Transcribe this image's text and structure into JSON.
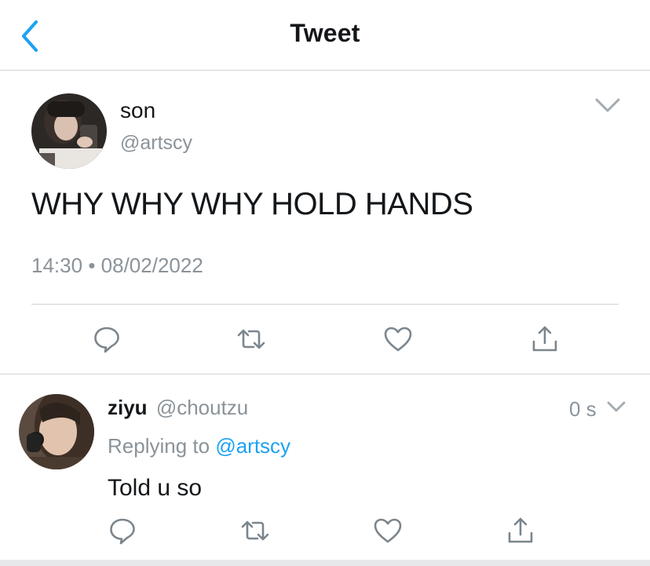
{
  "header": {
    "title": "Tweet",
    "back_icon": "chevron-left-icon",
    "accent": "#1da1f2"
  },
  "tweet": {
    "author_name": "son",
    "author_handle": "@artscy",
    "text": "WHY WHY WHY HOLD HANDS",
    "time": "14:30",
    "separator": "•",
    "date": "08/02/2022",
    "menu_icon": "chevron-down-icon",
    "actions": [
      "reply-icon",
      "retweet-icon",
      "like-icon",
      "share-icon"
    ]
  },
  "reply": {
    "author_name": "ziyu",
    "author_handle": "@choutzu",
    "time_ago": "0 s",
    "replying_prefix": "Replying to",
    "replying_to": "@artscy",
    "text": "Told u so",
    "menu_icon": "chevron-down-icon",
    "actions": [
      "reply-icon",
      "retweet-icon",
      "like-icon",
      "share-icon"
    ]
  },
  "colors": {
    "text": "#14171a",
    "secondary": "#8a939a",
    "divider": "#cfd3d6",
    "link": "#1da1f2"
  }
}
